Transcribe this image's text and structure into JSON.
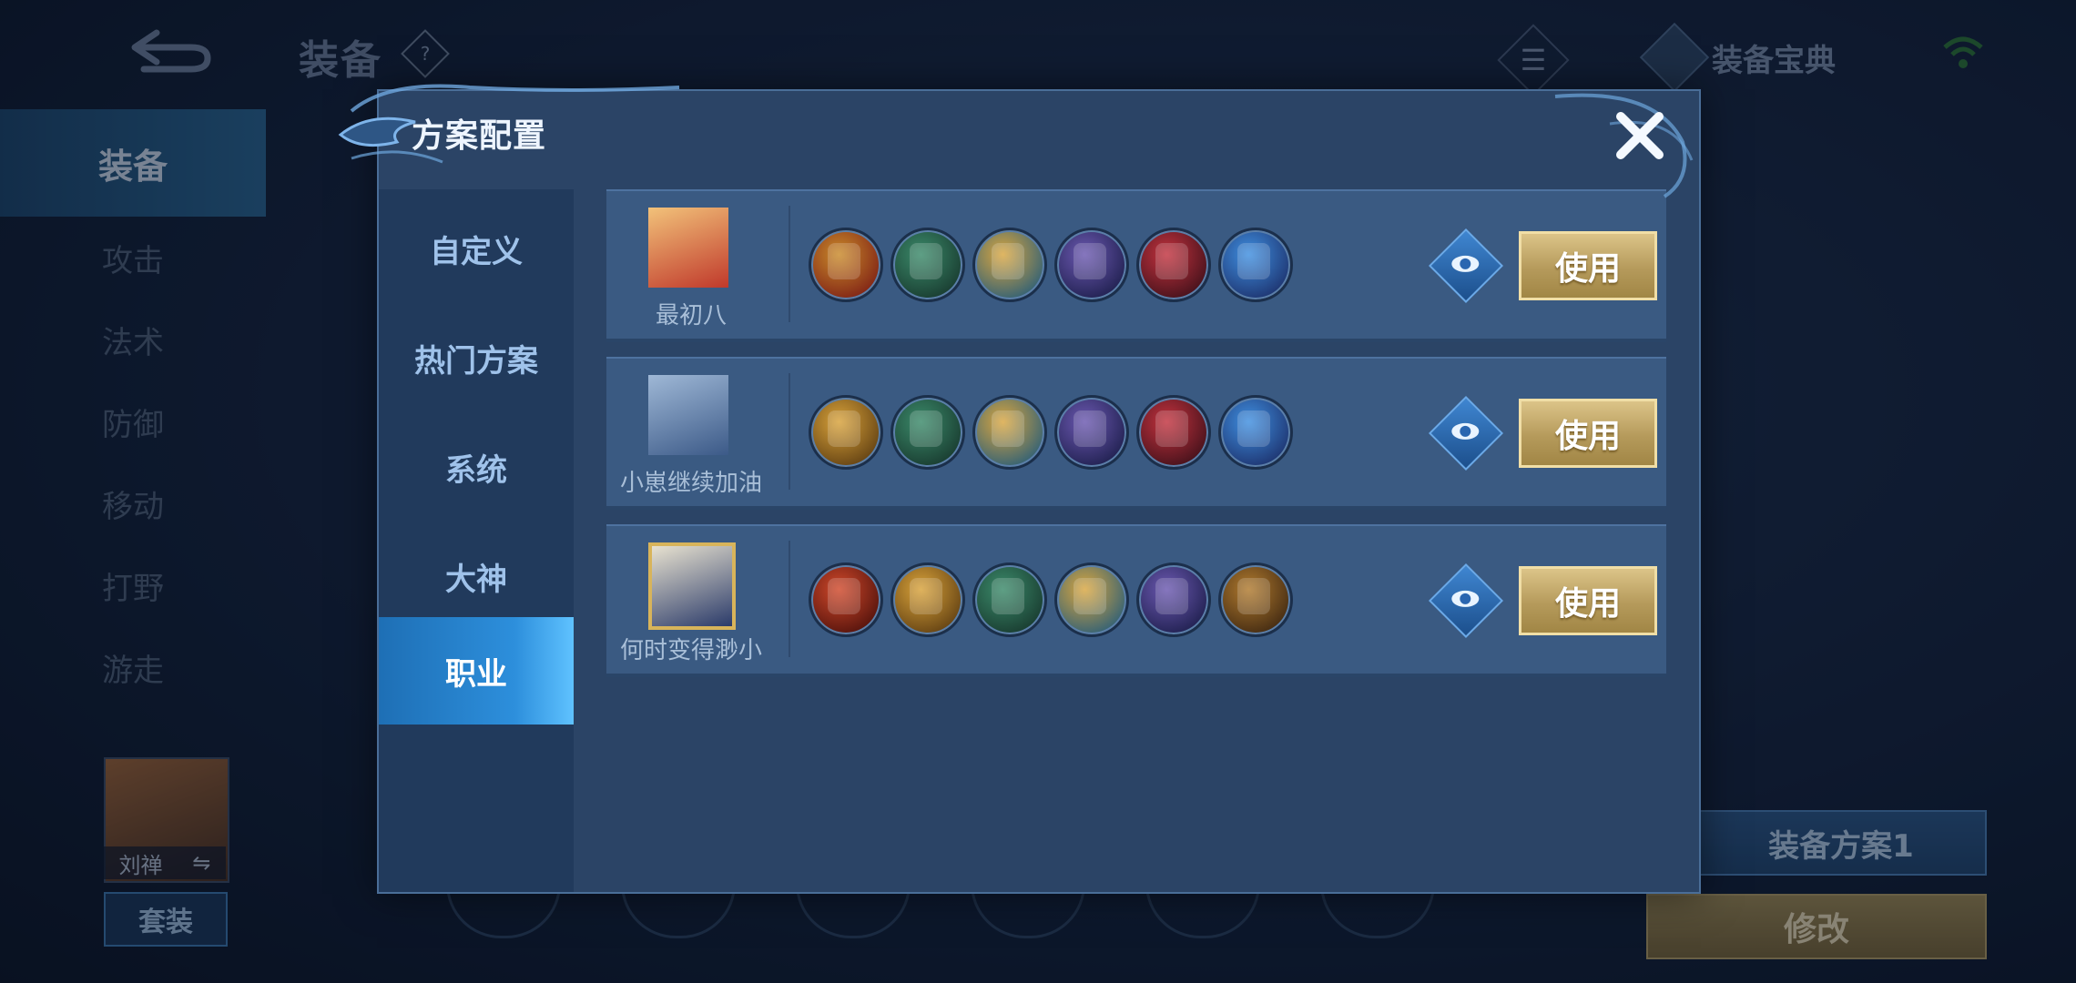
{
  "background": {
    "title": "装备",
    "help_symbol": "?",
    "list_symbol": "☰",
    "codex_label": "装备宝典",
    "sidebar": [
      {
        "label": "装备",
        "active": true
      },
      {
        "label": "攻击"
      },
      {
        "label": "法术"
      },
      {
        "label": "防御"
      },
      {
        "label": "移动"
      },
      {
        "label": "打野"
      },
      {
        "label": "游走"
      }
    ],
    "hero_name": "刘禅",
    "swap_symbol": "⇋",
    "suit_button": "套装",
    "plan_button": "装备方案1",
    "edit_button": "修改"
  },
  "modal": {
    "title": "方案配置",
    "tabs": [
      {
        "label": "自定义"
      },
      {
        "label": "热门方案"
      },
      {
        "label": "系统"
      },
      {
        "label": "大神"
      },
      {
        "label": "职业",
        "active": true
      }
    ],
    "plans": [
      {
        "name": "最初八",
        "avatar_icon": "straw-hat-avatar-icon",
        "items": [
          {
            "icon": "gold-red-gem-item-icon",
            "colors": [
              "#c98a2a",
              "#7a1a14"
            ]
          },
          {
            "icon": "boots-item-icon",
            "colors": [
              "#3b8a6a",
              "#16352b"
            ]
          },
          {
            "icon": "gold-crest-item-icon",
            "colors": [
              "#d9a640",
              "#235b7a"
            ]
          },
          {
            "icon": "purple-cape-item-icon",
            "colors": [
              "#6b58b0",
              "#1a1c48"
            ]
          },
          {
            "icon": "red-armor-item-icon",
            "colors": [
              "#c2323e",
              "#3a0f18"
            ]
          },
          {
            "icon": "blue-gold-armor-item-icon",
            "colors": [
              "#3f8fe0",
              "#1b2c66"
            ]
          }
        ],
        "use_label": "使用"
      },
      {
        "name": "小崽继续加油",
        "avatar_icon": "anime-boy-avatar-icon",
        "items": [
          {
            "icon": "gold-armor-item-icon",
            "colors": [
              "#d8a23a",
              "#5a3a10"
            ]
          },
          {
            "icon": "boots-item-icon",
            "colors": [
              "#3b8a6a",
              "#16352b"
            ]
          },
          {
            "icon": "gold-crest-item-icon",
            "colors": [
              "#d9a640",
              "#235b7a"
            ]
          },
          {
            "icon": "purple-cape-item-icon",
            "colors": [
              "#6b58b0",
              "#1a1c48"
            ]
          },
          {
            "icon": "red-armor-item-icon",
            "colors": [
              "#c2323e",
              "#3a0f18"
            ]
          },
          {
            "icon": "blue-gold-armor-item-icon",
            "colors": [
              "#3f8fe0",
              "#1b2c66"
            ]
          }
        ],
        "use_label": "使用"
      },
      {
        "name": "何时变得渺小",
        "avatar_icon": "framed-hero-avatar-icon",
        "items": [
          {
            "icon": "red-orb-item-icon",
            "colors": [
              "#d0482a",
              "#4a0f0a"
            ]
          },
          {
            "icon": "gold-armor-item-icon",
            "colors": [
              "#d8a23a",
              "#5a3a10"
            ]
          },
          {
            "icon": "boots-item-icon",
            "colors": [
              "#3b8a6a",
              "#16352b"
            ]
          },
          {
            "icon": "gold-crest-item-icon",
            "colors": [
              "#d9a640",
              "#235b7a"
            ]
          },
          {
            "icon": "purple-cape-item-icon",
            "colors": [
              "#6b58b0",
              "#1a1c48"
            ]
          },
          {
            "icon": "bronze-armor-item-icon",
            "colors": [
              "#b07a2e",
              "#3a2410"
            ]
          }
        ],
        "use_label": "使用"
      }
    ]
  },
  "colors": {
    "accent_blue": "#2d8fdc",
    "gold_button": "#c9ae6a",
    "panel": "#2b4466"
  }
}
